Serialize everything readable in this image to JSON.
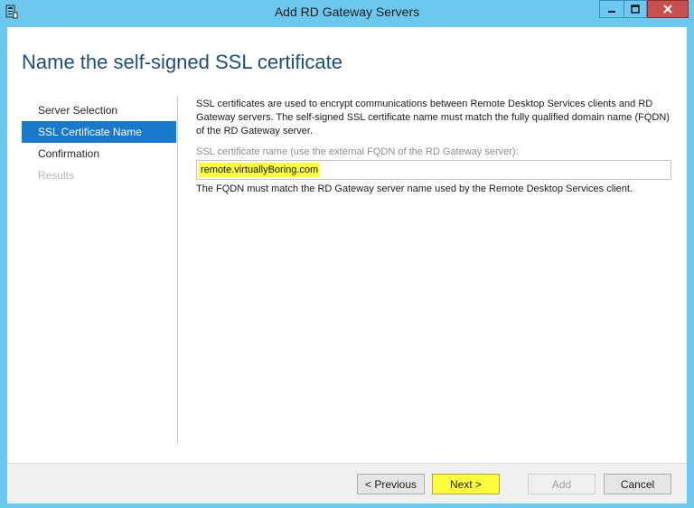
{
  "window": {
    "title": "Add RD Gateway Servers",
    "icons": {
      "app": "server-manager-icon",
      "minimize": "minimize-icon",
      "maximize": "maximize-icon",
      "close": "close-icon"
    }
  },
  "page": {
    "title": "Name the self-signed SSL certificate"
  },
  "nav": {
    "items": [
      {
        "label": "Server Selection",
        "state": "normal"
      },
      {
        "label": "SSL Certificate Name",
        "state": "active"
      },
      {
        "label": "Confirmation",
        "state": "normal"
      },
      {
        "label": "Results",
        "state": "disabled"
      }
    ]
  },
  "main": {
    "description": "SSL certificates are used to encrypt communications between Remote Desktop Services clients and RD Gateway servers. The self-signed SSL certificate name must match the fully qualified domain name (FQDN) of the RD Gateway server.",
    "field_label": "SSL certificate name (use the external FQDN of the RD Gateway server):",
    "field_value": "remote.virtuallyBoring.com",
    "hint": "The FQDN must match the RD Gateway server name used by the Remote Desktop Services client."
  },
  "footer": {
    "previous_label": "< Previous",
    "next_label": "Next >",
    "add_label": "Add",
    "cancel_label": "Cancel"
  },
  "colors": {
    "frame": "#6dc8ef",
    "close": "#c7504f",
    "accent": "#1979ca",
    "highlight": "#fdfd3a",
    "title_text": "#1e4e79"
  }
}
